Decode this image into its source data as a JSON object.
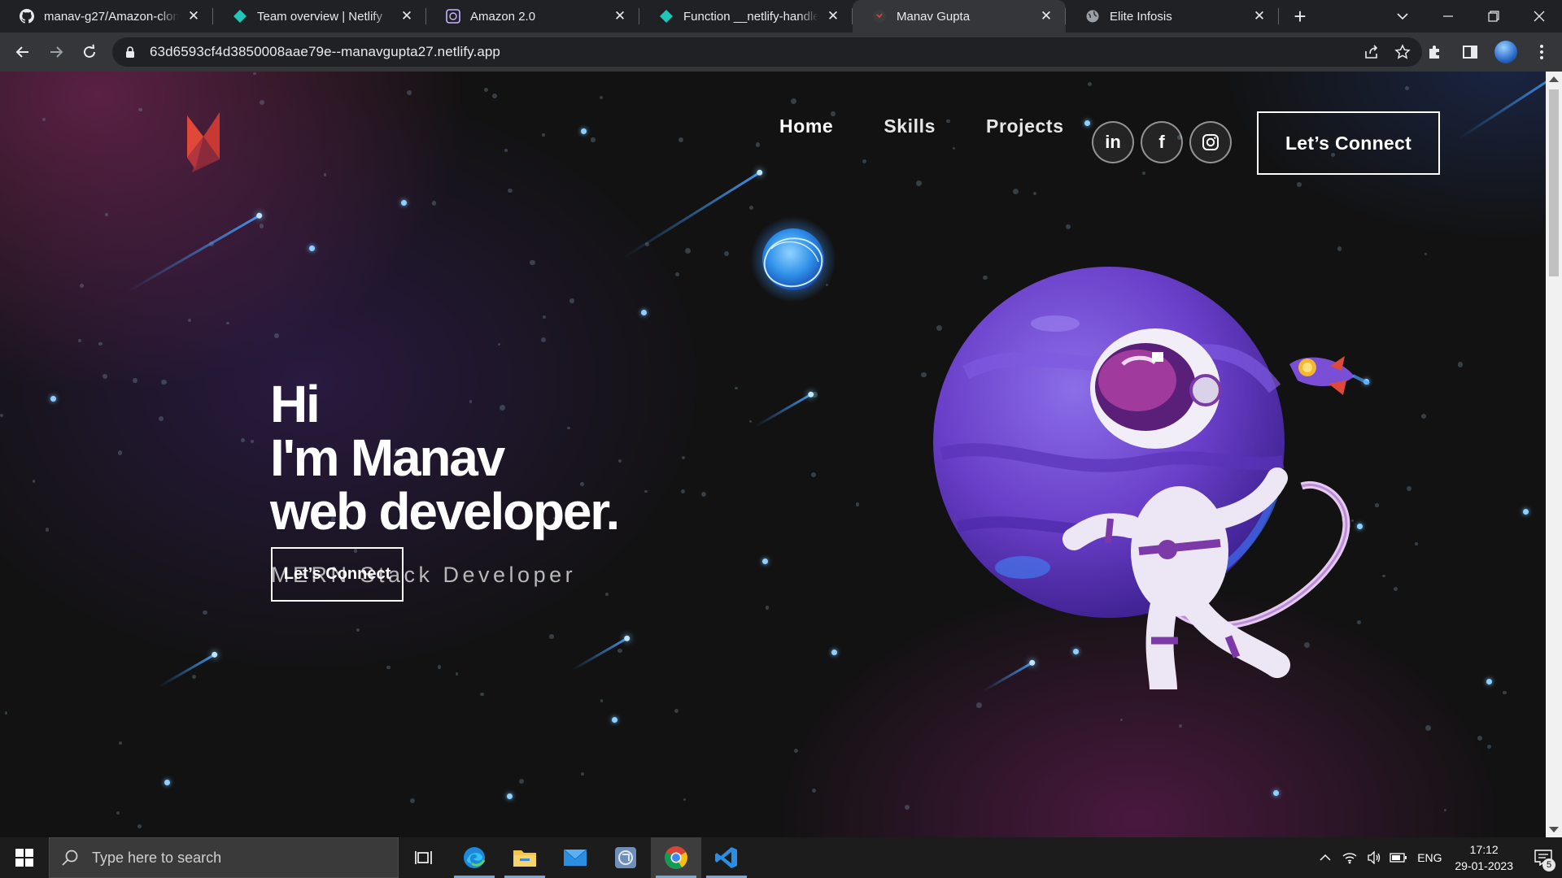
{
  "browser": {
    "tabs": [
      {
        "title": "manav-g27/Amazon-clone",
        "favicon": "github-icon"
      },
      {
        "title": "Team overview | Netlify",
        "favicon": "netlify-icon"
      },
      {
        "title": "Amazon 2.0",
        "favicon": "app-icon"
      },
      {
        "title": "Function __netlify-handler",
        "favicon": "netlify-icon"
      },
      {
        "title": "Manav Gupta",
        "favicon": "site-icon",
        "active": true
      },
      {
        "title": "Elite Infosis",
        "favicon": "globe-icon"
      }
    ],
    "close_glyph": "✕",
    "new_tab_glyph": "+",
    "url": "63d6593cf4d3850008aae79e--manavgupta27.netlify.app"
  },
  "site": {
    "nav": {
      "links": [
        "Home",
        "Skills",
        "Projects"
      ],
      "socials": [
        "linkedin-icon",
        "facebook-icon",
        "instagram-icon"
      ],
      "linkedin_text": "in",
      "facebook_text": "f",
      "cta": "Let’s Connect"
    },
    "hero": {
      "line1": "Hi",
      "line2": "I'm Manav",
      "line3": "web developer.",
      "subtitle": "MERN Stack Developer",
      "cta": "Let’s Connect"
    }
  },
  "taskbar": {
    "search_placeholder": "Type here to search",
    "language": "ENG",
    "time": "17:12",
    "date": "29-01-2023",
    "notification_count": "5"
  }
}
